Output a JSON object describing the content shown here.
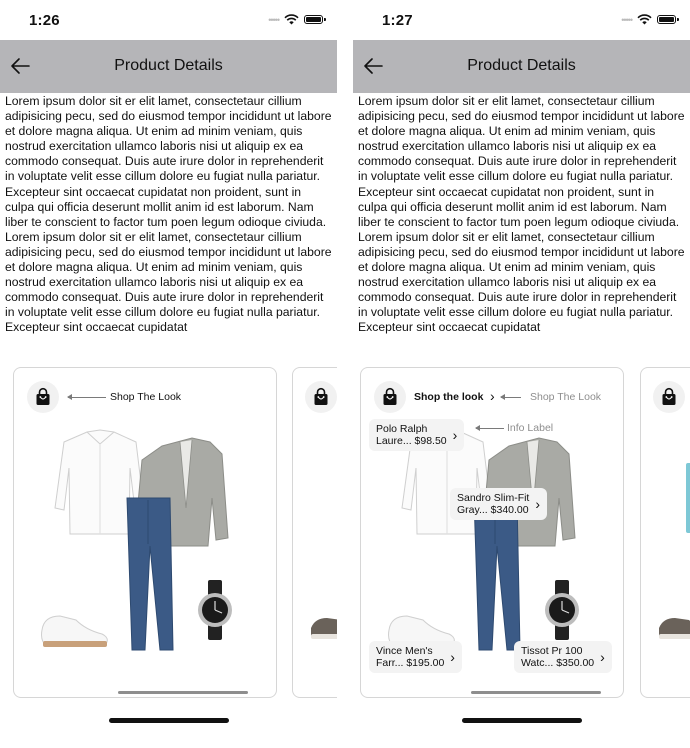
{
  "screens": [
    {
      "status": {
        "time": "1:26"
      },
      "nav": {
        "title": "Product Details"
      },
      "description": "Lorem ipsum dolor sit er elit lamet, consectetaur cillium adipisicing pecu, sed do eiusmod tempor incididunt ut labore et dolore magna aliqua. Ut enim ad minim veniam, quis nostrud exercitation ullamco laboris nisi ut aliquip ex ea commodo consequat. Duis aute irure dolor in reprehenderit in voluptate velit esse cillum dolore eu fugiat nulla pariatur. Excepteur sint occaecat cupidatat non proident, sunt in culpa qui officia deserunt mollit anim id est laborum. Nam liber te conscient to factor tum poen legum odioque civiuda. Lorem ipsum dolor sit er elit lamet, consectetaur cillium adipisicing pecu, sed do eiusmod tempor incididunt ut labore et dolore magna aliqua. Ut enim ad minim veniam, quis nostrud exercitation ullamco laboris nisi ut aliquip ex ea commodo consequat. Duis aute irure dolor in reprehenderit in voluptate velit esse cillum dolore eu fugiat nulla pariatur. Excepteur sint occaecat cupidatat",
      "card": {
        "annotation": "Shop The  Look"
      }
    },
    {
      "status": {
        "time": "1:27"
      },
      "nav": {
        "title": "Product Details"
      },
      "description": "Lorem ipsum dolor sit er elit lamet, consectetaur cillium adipisicing pecu, sed do eiusmod tempor incididunt ut labore et dolore magna aliqua. Ut enim ad minim veniam, quis nostrud exercitation ullamco laboris nisi ut aliquip ex ea commodo consequat. Duis aute irure dolor in reprehenderit in voluptate velit esse cillum dolore eu fugiat nulla pariatur. Excepteur sint occaecat cupidatat non proident, sunt in culpa qui officia deserunt mollit anim id est laborum. Nam liber te conscient to factor tum poen legum odioque civiuda. Lorem ipsum dolor sit er elit lamet, consectetaur cillium adipisicing pecu, sed do eiusmod tempor incididunt ut labore et dolore magna aliqua. Ut enim ad minim veniam, quis nostrud exercitation ullamco laboris nisi ut aliquip ex ea commodo consequat. Duis aute irure dolor in reprehenderit in voluptate velit esse cillum dolore eu fugiat nulla pariatur. Excepteur sint occaecat cupidatat",
      "card": {
        "shop_label": "Shop the look",
        "annotation": "Shop The Look",
        "info_annotation": "Info Label",
        "products": [
          {
            "line1": "Polo Ralph",
            "line2": "Laure... $98.50"
          },
          {
            "line1": "Sandro Slim-Fit",
            "line2": "Gray... $340.00"
          },
          {
            "line1": "Vince Men's",
            "line2": "Farr... $195.00"
          },
          {
            "line1": "Tissot Pr 100",
            "line2": "Watc... $350.00"
          }
        ]
      }
    }
  ],
  "icons": {
    "back": "arrow-left-icon",
    "bag": "shopping-bag-icon",
    "chevron": "chevron-right-icon",
    "wifi": "wifi-icon",
    "battery": "battery-icon"
  },
  "colors": {
    "navbar": "#b5b5b8",
    "pill": "#f3f3f3",
    "jacket": "#a9aaa5",
    "trousers": "#3b5a86"
  }
}
